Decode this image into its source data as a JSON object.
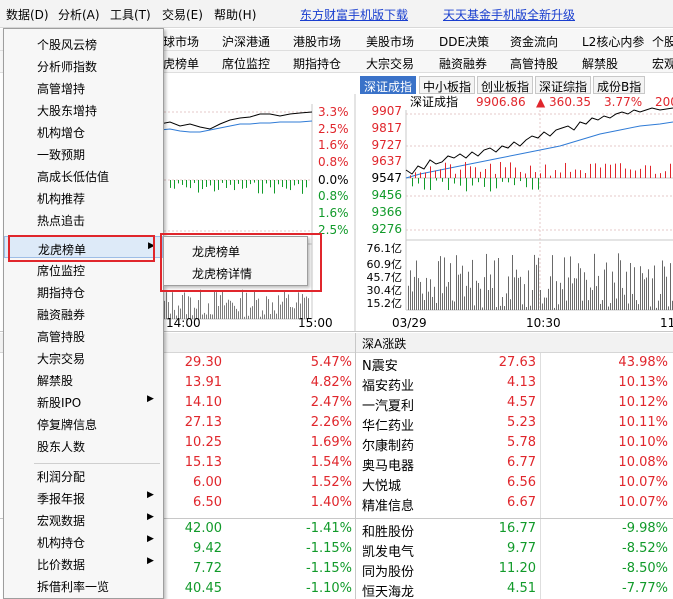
{
  "menubar": {
    "items": [
      "数据(D)",
      "分析(A)",
      "工具(T)",
      "交易(E)",
      "帮助(H)"
    ],
    "links": [
      "东方财富手机版下载",
      "天天基金手机版全新升级"
    ]
  },
  "toolbar1": [
    "球市场",
    "沪深港通",
    "港股市场",
    "美股市场",
    "DDE决策",
    "资金流向",
    "L2核心内参",
    "个股"
  ],
  "toolbar2": [
    "虎榜单",
    "席位监控",
    "期指持仓",
    "大宗交易",
    "融资融券",
    "高管持股",
    "解禁股",
    "宏观"
  ],
  "index_tabs": [
    "深证成指",
    "中小板指",
    "创业板指",
    "深证综指",
    "成份B指"
  ],
  "left_chart": {
    "pct_labels": [
      "3.3%",
      "2.5%",
      "1.6%",
      "0.8%",
      "0.0%",
      "0.8%",
      "1.6%",
      "2.5%"
    ],
    "time_labels": [
      "14:00",
      "15:00"
    ]
  },
  "right_chart": {
    "quote": {
      "name": "深证成指",
      "price": "9906.86",
      "change": "▲ 360.35",
      "pct": "3.77%",
      "extra": "200"
    },
    "price_labels": [
      "9907",
      "9817",
      "9727",
      "9637",
      "9547",
      "9456",
      "9366",
      "9276"
    ],
    "volume_labels": [
      "76.1亿",
      "60.9亿",
      "45.7亿",
      "30.4亿",
      "15.2亿"
    ],
    "time_labels": [
      "03/29",
      "10:30",
      "11"
    ]
  },
  "table": {
    "right_header": "深A涨跌",
    "left_rows": [
      {
        "price": "29.30",
        "pct": "5.47%"
      },
      {
        "price": "13.91",
        "pct": "4.82%"
      },
      {
        "price": "14.10",
        "pct": "2.47%"
      },
      {
        "price": "27.13",
        "pct": "2.26%"
      },
      {
        "price": "10.25",
        "pct": "1.69%"
      },
      {
        "price": "15.13",
        "pct": "1.54%"
      },
      {
        "price": "6.00",
        "pct": "1.52%"
      },
      {
        "price": "6.50",
        "pct": "1.40%"
      },
      {
        "price": "42.00",
        "pct": "-1.41%"
      },
      {
        "price": "9.42",
        "pct": "-1.15%"
      },
      {
        "price": "7.72",
        "pct": "-1.15%"
      },
      {
        "price": "40.45",
        "pct": "-1.10%"
      }
    ],
    "right_rows": [
      {
        "name": "N震安",
        "price": "27.63",
        "pct": "43.98%"
      },
      {
        "name": "福安药业",
        "price": "4.13",
        "pct": "10.13%"
      },
      {
        "name": "一汽夏利",
        "price": "4.57",
        "pct": "10.12%"
      },
      {
        "name": "华仁药业",
        "price": "5.23",
        "pct": "10.11%"
      },
      {
        "name": "尔康制药",
        "price": "5.78",
        "pct": "10.10%"
      },
      {
        "name": "奥马电器",
        "price": "6.77",
        "pct": "10.08%"
      },
      {
        "name": "大悦城",
        "price": "6.56",
        "pct": "10.07%"
      },
      {
        "name": "精准信息",
        "price": "6.67",
        "pct": "10.07%"
      },
      {
        "name": "和胜股份",
        "price": "16.77",
        "pct": "-9.98%"
      },
      {
        "name": "凯发电气",
        "price": "9.77",
        "pct": "-8.52%"
      },
      {
        "name": "同为股份",
        "price": "11.20",
        "pct": "-8.50%"
      },
      {
        "name": "恒天海龙",
        "price": "4.51",
        "pct": "-7.77%"
      }
    ]
  },
  "menu": {
    "items": [
      "个股风云榜",
      "分析师指数",
      "高管增持",
      "大股东增持",
      "机构增仓",
      "一致预期",
      "高成长低估值",
      "机构推荐",
      "热点追击",
      "龙虎榜单",
      "席位监控",
      "期指持仓",
      "融资融券",
      "高管持股",
      "大宗交易",
      "解禁股",
      "新股IPO",
      "停复牌信息",
      "股东人数",
      "利润分配",
      "季报年报",
      "宏观数据",
      "机构持仓",
      "比价数据",
      "拆借利率一览"
    ]
  },
  "submenu": {
    "items": [
      "龙虎榜单",
      "龙虎榜详情"
    ]
  }
}
